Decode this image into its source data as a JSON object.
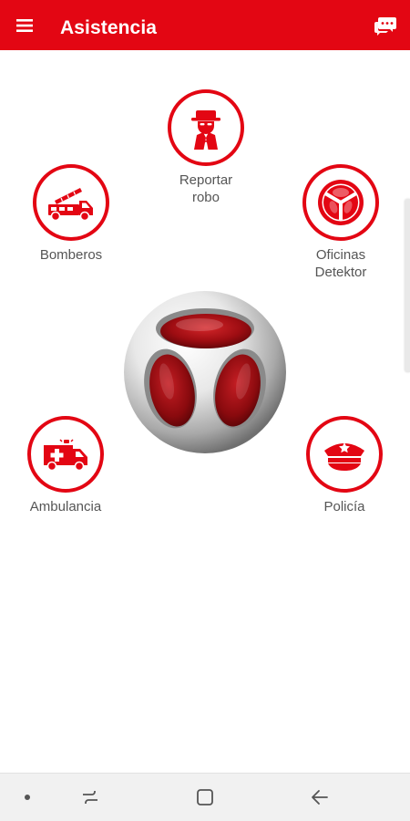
{
  "header": {
    "title": "Asistencia",
    "menu_icon": "hamburger-menu-icon",
    "chat_icon": "chat-icon"
  },
  "services": {
    "reportar_robo": {
      "line1": "Reportar",
      "line2": "robo",
      "icon": "thief-icon"
    },
    "oficinas": {
      "line1": "Oficinas",
      "line2": "Detektor",
      "icon": "detektor-logo-icon"
    },
    "bomberos": {
      "label": "Bomberos",
      "icon": "fire-truck-icon"
    },
    "ambulancia": {
      "label": "Ambulancia",
      "icon": "ambulance-icon"
    },
    "policia": {
      "label": "Policía",
      "icon": "police-cap-icon"
    }
  },
  "center": {
    "icon": "detektor-logo"
  },
  "navbar": {
    "dot_icon": "dot-icon",
    "recents_icon": "recent-apps-icon",
    "home_icon": "home-square-icon",
    "back_icon": "back-arrow-icon"
  },
  "colors": {
    "brand_red": "#e30613",
    "label_gray": "#555555",
    "background": "#ffffff",
    "navbar": "#f1f1f1"
  }
}
